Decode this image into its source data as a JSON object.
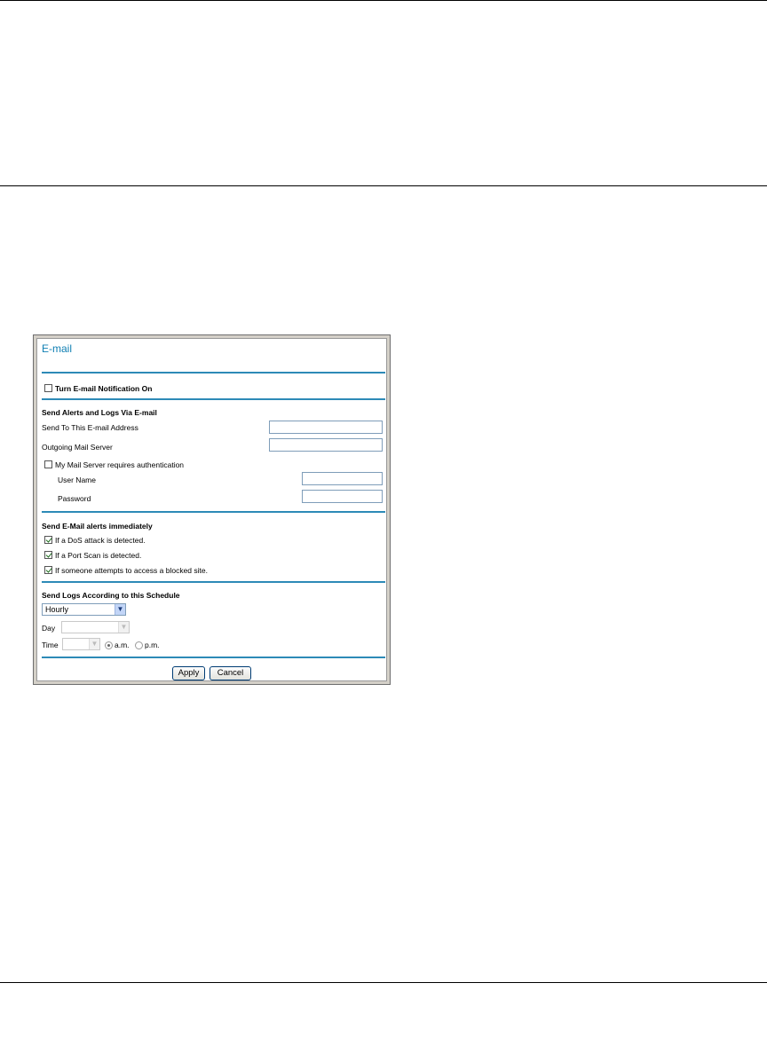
{
  "window": {
    "title": "E-mail",
    "notification": {
      "label": "Turn E-mail Notification On",
      "checked": false
    },
    "send_section": {
      "heading": "Send Alerts and Logs Via E-mail",
      "send_to_label": "Send To This E-mail Address",
      "send_to_value": "",
      "mail_server_label": "Outgoing Mail Server",
      "mail_server_value": "",
      "auth": {
        "label": "My Mail Server requires authentication",
        "checked": false
      },
      "username_label": "User Name",
      "username_value": "",
      "password_label": "Password",
      "password_value": ""
    },
    "alerts_section": {
      "heading": "Send E-Mail alerts immediately",
      "items": [
        {
          "label": "If a DoS attack is detected.",
          "checked": true
        },
        {
          "label": "If a Port Scan is detected.",
          "checked": true
        },
        {
          "label": "If someone attempts to access a blocked site.",
          "checked": true
        }
      ]
    },
    "schedule_section": {
      "heading": "Send Logs According to this Schedule",
      "frequency_value": "Hourly",
      "day_label": "Day",
      "day_value": "",
      "time_label": "Time",
      "time_value": "",
      "am_label": "a.m.",
      "pm_label": "p.m.",
      "am_selected": true
    },
    "buttons": {
      "apply": "Apply",
      "cancel": "Cancel"
    }
  },
  "colors": {
    "accent": "#2d8ab7",
    "title": "#0f7fb3"
  }
}
